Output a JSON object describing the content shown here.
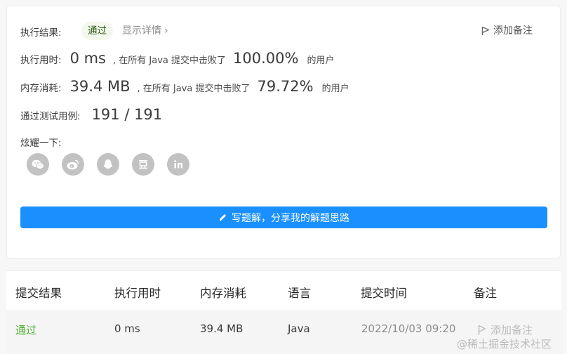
{
  "result": {
    "label": "执行结果:",
    "status": "通过",
    "details_link": "显示详情",
    "add_note": "添加备注"
  },
  "runtime": {
    "label": "执行用时:",
    "value": "0 ms",
    "prefix": ", 在所有 Java 提交中击败了",
    "percent": "100.00%",
    "suffix": "的用户"
  },
  "memory": {
    "label": "内存消耗:",
    "value": "39.4 MB",
    "prefix": ", 在所有 Java 提交中击败了",
    "percent": "79.72%",
    "suffix": "的用户"
  },
  "testcases": {
    "label": "通过测试用例:",
    "value": "191 / 191"
  },
  "share": {
    "label": "炫耀一下:",
    "icons": [
      "wechat-icon",
      "weibo-icon",
      "qq-icon",
      "douban-icon",
      "linkedin-icon"
    ]
  },
  "write_button": "写题解，分享我的解题思路",
  "table": {
    "headers": [
      "提交结果",
      "执行用时",
      "内存消耗",
      "语言",
      "提交时间",
      "备注"
    ],
    "row": {
      "status": "通过",
      "runtime": "0 ms",
      "memory": "39.4 MB",
      "language": "Java",
      "time": "2022/10/03 09:20",
      "note": "添加备注"
    }
  },
  "watermark": "@稀土掘金技术社区",
  "colors": {
    "accent": "#1a90ff",
    "pass": "#4caf2e",
    "icon_gray": "#c2c2c2"
  }
}
